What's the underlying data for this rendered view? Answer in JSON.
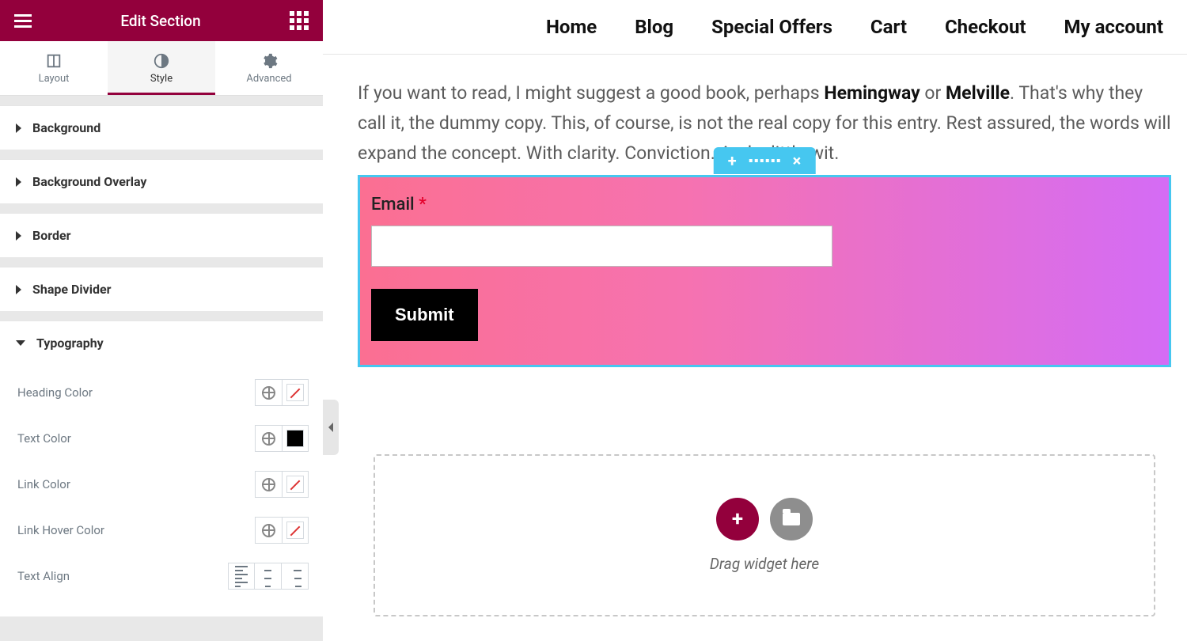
{
  "panel": {
    "title": "Edit Section",
    "tabs": {
      "layout": "Layout",
      "style": "Style",
      "advanced": "Advanced",
      "active": "style"
    },
    "sections": {
      "background": "Background",
      "background_overlay": "Background Overlay",
      "border": "Border",
      "shape_divider": "Shape Divider",
      "typography": "Typography"
    },
    "typography_controls": {
      "heading_color": {
        "label": "Heading Color",
        "value": "none"
      },
      "text_color": {
        "label": "Text Color",
        "value": "#000000"
      },
      "link_color": {
        "label": "Link Color",
        "value": "none"
      },
      "link_hover_color": {
        "label": "Link Hover Color",
        "value": "none"
      },
      "text_align": {
        "label": "Text Align",
        "value": null
      }
    }
  },
  "site": {
    "nav": [
      "Home",
      "Blog",
      "Special Offers",
      "Cart",
      "Checkout",
      "My account"
    ],
    "paragraph": {
      "p1": "If you want to read, I might suggest a good book, perhaps ",
      "h": "Hemingway",
      "or": " or ",
      "m": "Melville",
      "p2": ". That's why they call it, the dummy copy. This, of course, is not the real copy for this entry. Rest assured, the words will expand the concept. With clarity. Conviction. And a little wit."
    },
    "form": {
      "email_label": "Email ",
      "required": "*",
      "email_value": "",
      "submit": "Submit"
    },
    "drop_hint": "Drag widget here"
  }
}
